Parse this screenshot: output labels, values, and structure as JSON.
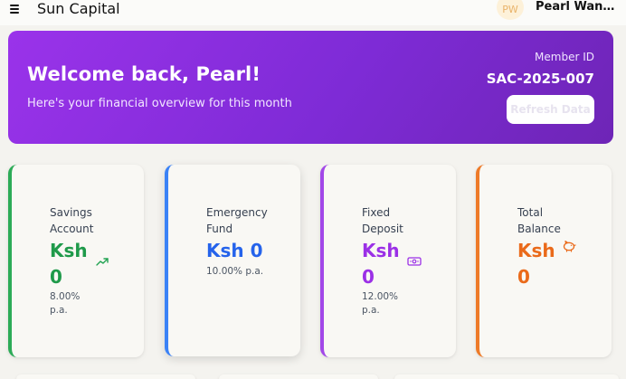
{
  "header": {
    "brand": "Sun Capital",
    "avatar_initials": "PW",
    "user_name": "Pearl Wangui..."
  },
  "hero": {
    "title": "Welcome back, Pearl!",
    "subtitle": "Here's your financial overview for this month",
    "member_label": "Member ID",
    "member_id": "SAC-2025-007",
    "refresh_label": "Refresh Data"
  },
  "cards": [
    {
      "title": "Savings Account",
      "value": "Ksh 0",
      "rate": "8.00% p.a.",
      "icon": "trending-up-icon",
      "color": "#2cab57"
    },
    {
      "title": "Emergency Fund",
      "value": "Ksh 0",
      "rate": "10.00% p.a.",
      "color": "#3b82f6"
    },
    {
      "title": "Fixed Deposit",
      "value": "Ksh 0",
      "rate": "12.00% p.a.",
      "icon": "banknote-icon",
      "color": "#a247e8"
    },
    {
      "title": "Total Balance",
      "value": "Ksh 0",
      "icon": "piggy-bank-icon",
      "color": "#ee7a28"
    }
  ],
  "colors": {
    "hero_gradient_start": "#9a33ea",
    "hero_gradient_end": "#6e25b6",
    "page_background": "#f4f3ef"
  }
}
